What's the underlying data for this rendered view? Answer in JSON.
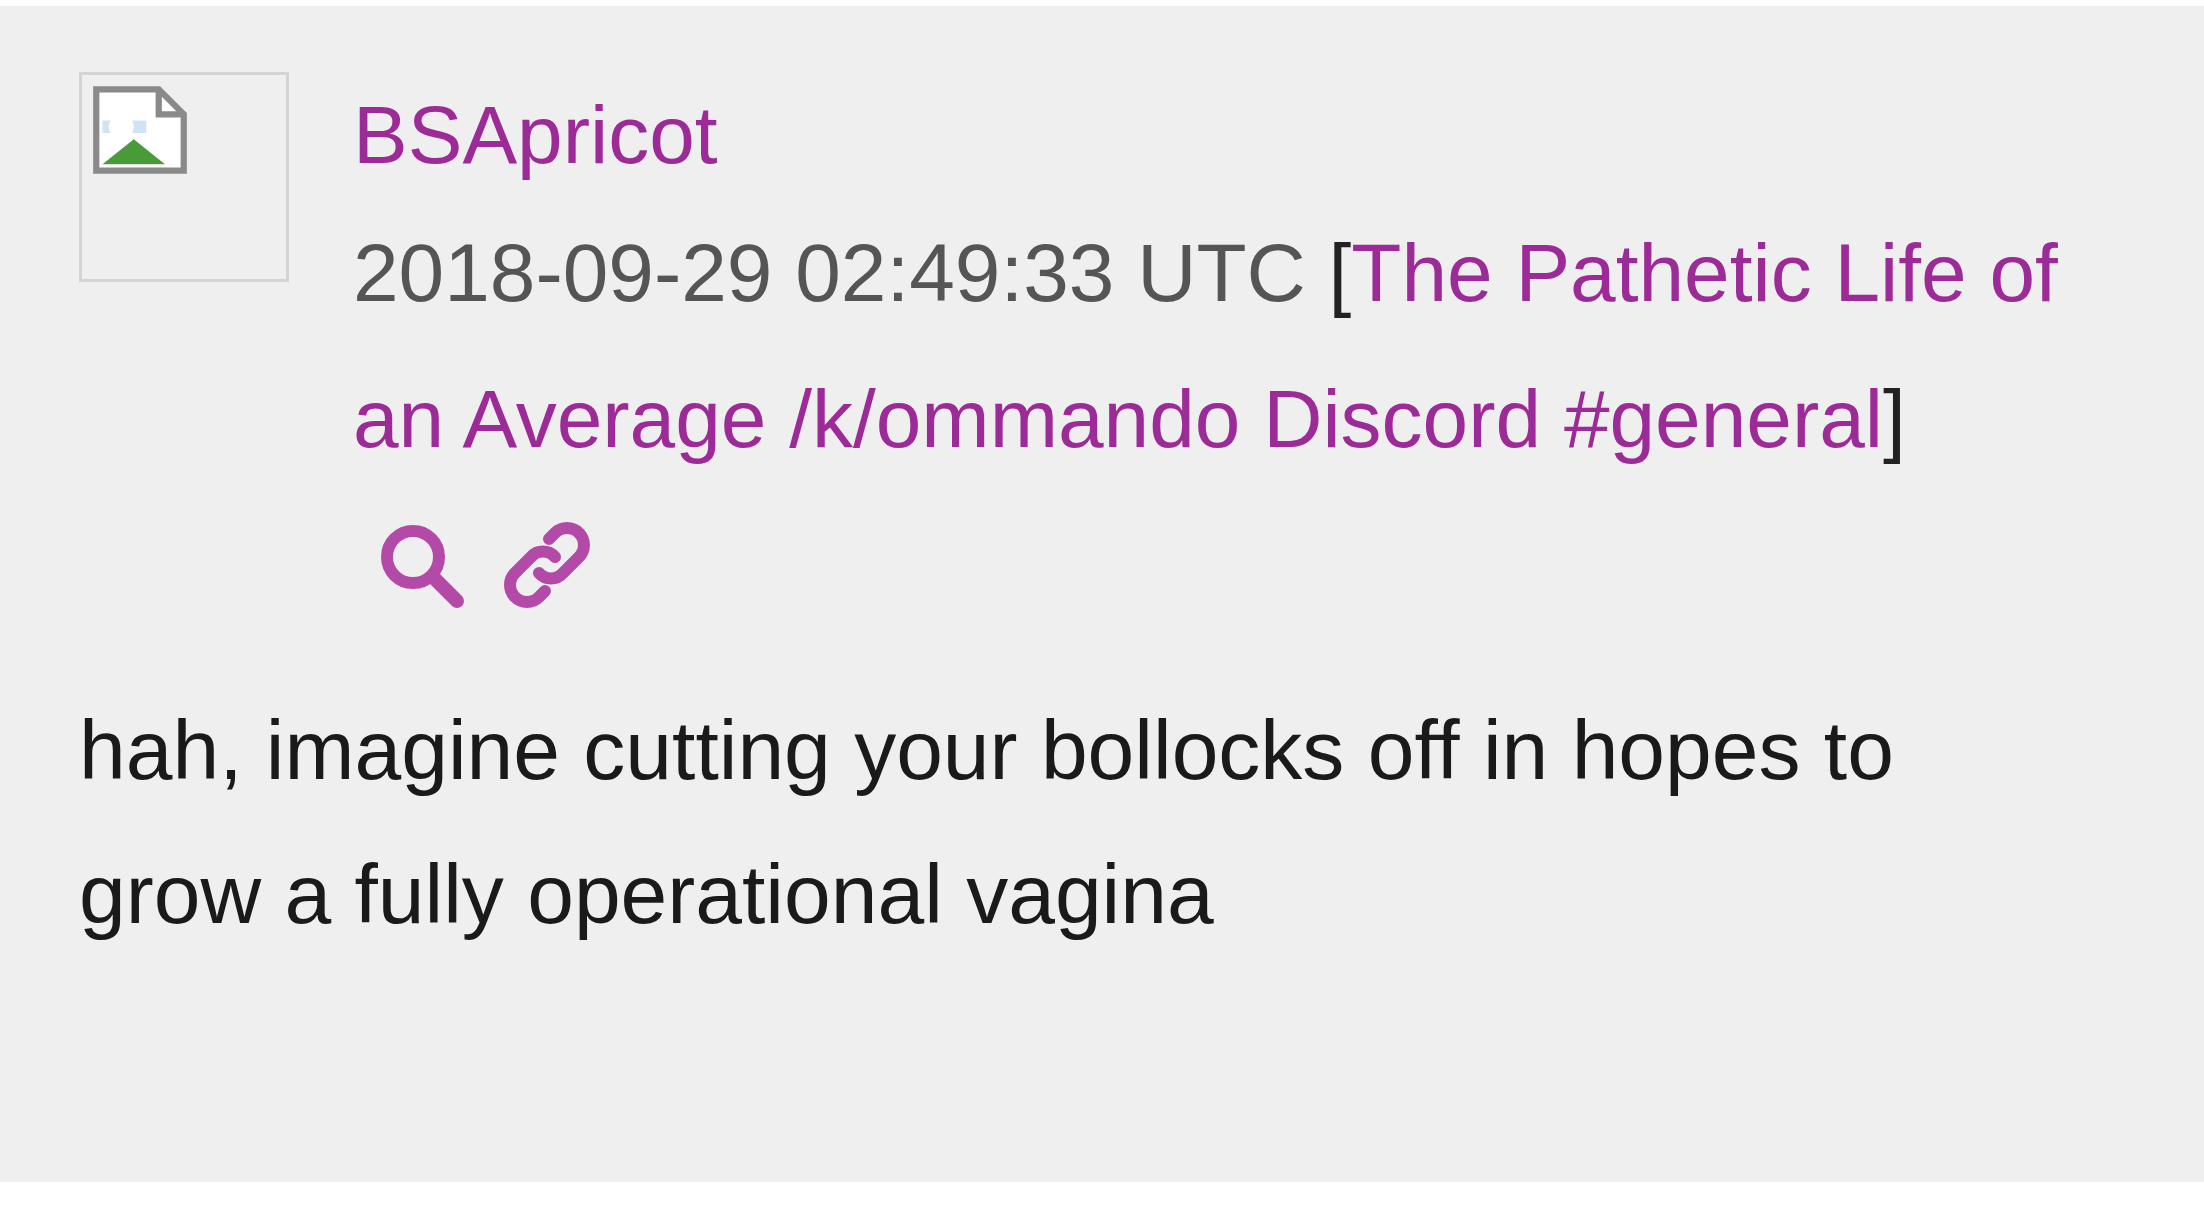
{
  "message": {
    "author": "BSApricot",
    "timestamp": "2018-09-29 02:49:33 UTC",
    "bracket_open": "[",
    "channel": "The Pathetic Life of an Average /k/ommando Discord #general",
    "bracket_close": "]",
    "body": "hah, imagine cutting your bollocks off in hopes to grow a fully operational vagina"
  }
}
